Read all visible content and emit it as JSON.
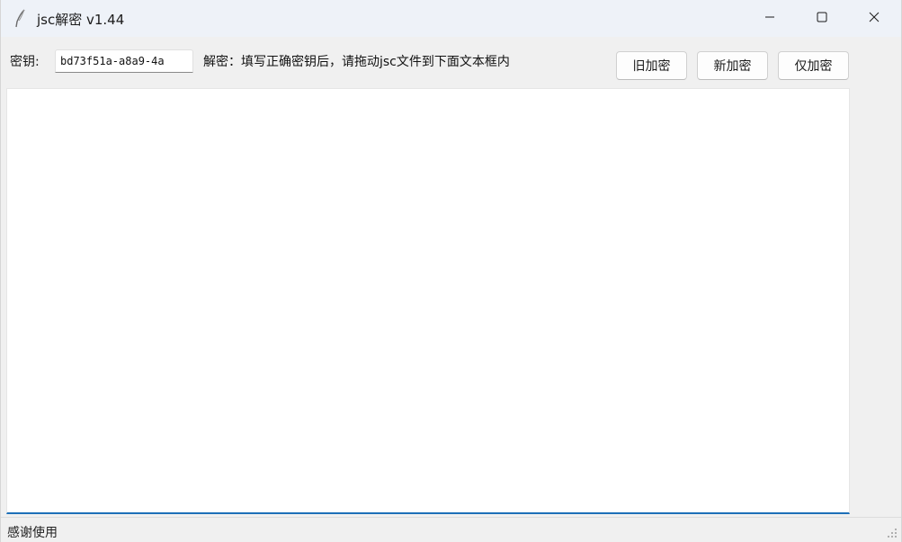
{
  "window": {
    "title": "jsc解密 v1.44",
    "icon": "quill-icon",
    "controls": {
      "minimize_icon": "minimize-icon",
      "maximize_icon": "maximize-icon",
      "close_icon": "close-icon"
    }
  },
  "toolbar": {
    "key_label": "密钥:",
    "key_value": "bd73f51a-a8a9-4a",
    "hint": "解密：填写正确密钥后，请拖动jsc文件到下面文本框内",
    "buttons": {
      "old_decrypt": "旧加密",
      "new_decrypt": "新加密",
      "encrypt_only": "仅加密"
    }
  },
  "main": {
    "drop_area_value": ""
  },
  "statusbar": {
    "text": "感谢使用"
  },
  "colors": {
    "accent": "#1d6fb8",
    "titlebar": "#eef2f8",
    "window_bg": "#f0f0f0"
  }
}
